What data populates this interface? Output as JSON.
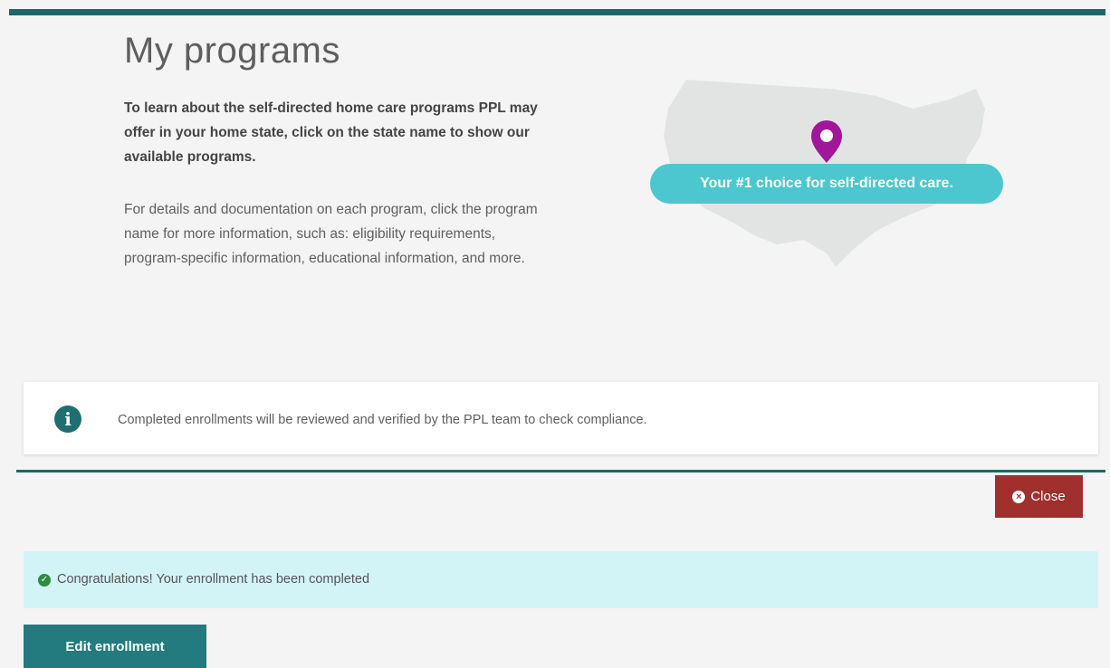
{
  "page": {
    "title": "My programs",
    "intro_bold": "To learn about the self-directed home care programs PPL may offer in your home state, click on the state name to show our available programs.",
    "intro_text": "For details and documentation on each program, click the program name for more information, such as: eligibility requirements, program-specific information, educational information, and more."
  },
  "map": {
    "tagline": "Your #1 choice for self-directed care.",
    "pin_color": "#a0179a",
    "badge_color": "#4cc7cf"
  },
  "info": {
    "message": "Completed enrollments will be reviewed and verified by the PPL team to check compliance."
  },
  "actions": {
    "close_label": "Close",
    "edit_label": "Edit enrollment"
  },
  "status": {
    "success_message": "Congratulations! Your enrollment has been completed"
  },
  "colors": {
    "teal_dark": "#1a6869",
    "close_red": "#a0302d",
    "success_bg": "#d3f4f7",
    "button_teal": "#237b7f"
  }
}
